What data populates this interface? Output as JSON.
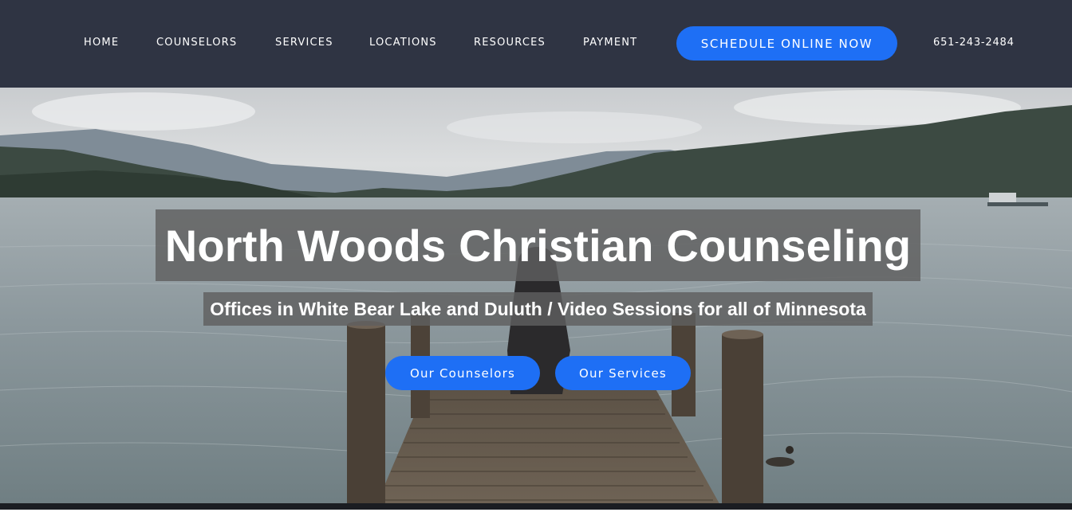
{
  "nav": {
    "items": [
      {
        "label": "HOME"
      },
      {
        "label": "COUNSELORS"
      },
      {
        "label": "SERVICES"
      },
      {
        "label": "LOCATIONS"
      },
      {
        "label": "RESOURCES"
      },
      {
        "label": "PAYMENT"
      }
    ],
    "cta_label": "SCHEDULE ONLINE NOW",
    "phone": "651-243-2484"
  },
  "hero": {
    "title": "North Woods Christian Counseling",
    "subtitle": "Offices in White Bear Lake and Duluth / Video Sessions for all of Minnesota",
    "buttons": [
      {
        "label": "Our Counselors"
      },
      {
        "label": "Our Services"
      }
    ]
  },
  "colors": {
    "nav_background": "#2f3443",
    "accent": "#1e6ff5",
    "text_overlay": "#5f5f5f"
  }
}
